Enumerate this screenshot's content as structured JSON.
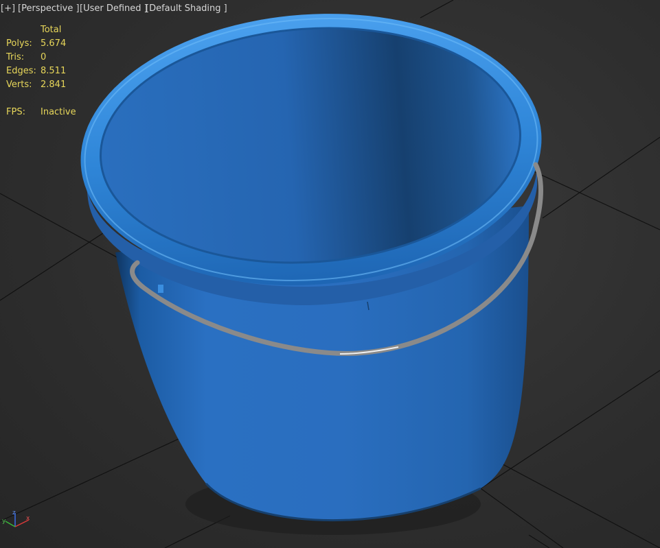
{
  "viewport": {
    "menus": {
      "plus": "+",
      "view": "Perspective",
      "camera_mode": "User Defined",
      "shading": "Default Shading"
    },
    "stats": {
      "header": "Total",
      "rows": [
        {
          "label": "Polys:",
          "value": "5.674"
        },
        {
          "label": "Tris:",
          "value": "0"
        },
        {
          "label": "Edges:",
          "value": "8.511"
        },
        {
          "label": "Verts:",
          "value": "2.841"
        }
      ],
      "fps_label": "FPS:",
      "fps_value": "Inactive"
    },
    "axis": {
      "x": "x",
      "y": "y",
      "z": "z"
    },
    "colors": {
      "background": "#2e2e2e",
      "grid": "#111111",
      "bucket": "#2a6fc0",
      "rim": "#2f86d8",
      "handle": "#8a8a8a",
      "stats_text": "#e8d75a",
      "menu_text": "#d7d7d7"
    }
  }
}
